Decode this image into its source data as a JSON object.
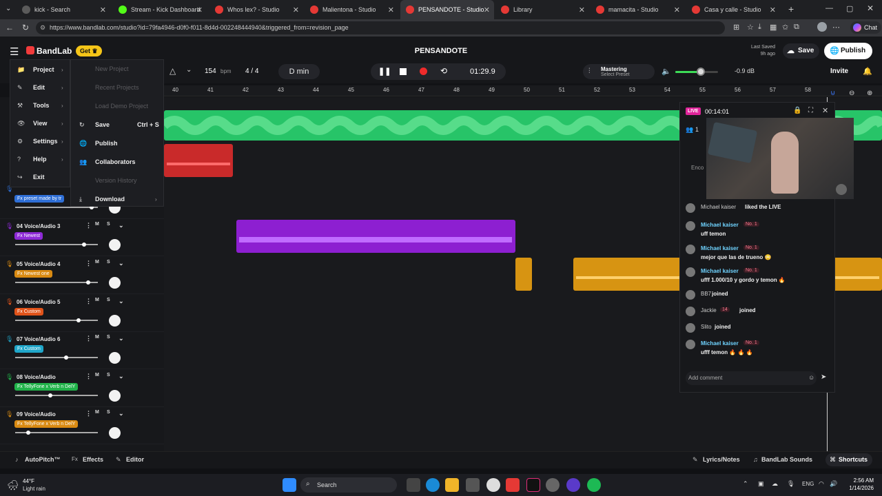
{
  "browser": {
    "tabs": [
      {
        "label": "kick - Search",
        "color": "#5b5b5b"
      },
      {
        "label": "Stream - Kick Dashboard",
        "color": "#53fc18"
      },
      {
        "label": "Whos lex? - Studio",
        "color": "#e53935"
      },
      {
        "label": "Malientona - Studio",
        "color": "#e53935"
      },
      {
        "label": "PENSANDOTE - Studio",
        "color": "#e53935"
      },
      {
        "label": "Library",
        "color": "#e53935"
      },
      {
        "label": "mamacita - Studio",
        "color": "#e53935"
      },
      {
        "label": "Casa y calle - Studio",
        "color": "#e53935"
      }
    ],
    "url": "https://www.bandlab.com/studio?id=79fa4946-d0f0-f011-8d4d-002248444940&triggered_from=revision_page",
    "profile_label": "Chat"
  },
  "header": {
    "logo": "BandLab",
    "get_label": "Get",
    "project_title": "PENSANDOTE",
    "last_saved_label": "Last Saved",
    "last_saved_time": "9h ago",
    "save_label": "Save",
    "publish_label": "Publish"
  },
  "transport": {
    "bpm": "154",
    "bpm_unit": "bpm",
    "time_signature": "4 / 4",
    "key": "D min",
    "time": "01:29.9",
    "mastering_label": "Mastering",
    "mastering_preset": "Select Preset",
    "volume_db": "-0.9 dB",
    "invite_label": "Invite",
    "volume_level": 0.6
  },
  "ruler": [
    "40",
    "41",
    "42",
    "43",
    "44",
    "45",
    "46",
    "47",
    "48",
    "49",
    "50",
    "51",
    "52",
    "53",
    "54",
    "55",
    "56",
    "57",
    "58"
  ],
  "main_menu": [
    {
      "label": "Project"
    },
    {
      "label": "Edit"
    },
    {
      "label": "Tools"
    },
    {
      "label": "View"
    },
    {
      "label": "Settings"
    },
    {
      "label": "Help"
    },
    {
      "label": "Exit"
    }
  ],
  "project_submenu": [
    {
      "label": "New Project",
      "disabled": true,
      "shortcut": ""
    },
    {
      "label": "Recent Projects",
      "disabled": true,
      "shortcut": ""
    },
    {
      "label": "Load Demo Project",
      "disabled": true,
      "shortcut": ""
    },
    {
      "label": "Save",
      "disabled": false,
      "shortcut": "Ctrl + S"
    },
    {
      "label": "Publish",
      "disabled": false,
      "shortcut": ""
    },
    {
      "label": "Collaborators",
      "disabled": false,
      "shortcut": ""
    },
    {
      "label": "Version History",
      "disabled": true,
      "shortcut": ""
    },
    {
      "label": "Download",
      "disabled": false,
      "shortcut": ""
    }
  ],
  "tracks": [
    {
      "name": "",
      "fx": "Fx preset made by tr",
      "fx_color": "#2f6fd6",
      "volume": 0.95
    },
    {
      "name": "04 Voice/Audio 3",
      "fx": "Fx Newest",
      "fx_color": "#8e2ad6",
      "volume": 0.85
    },
    {
      "name": "05 Voice/Audio 4",
      "fx": "Fx Newest one",
      "fx_color": "#d98a12",
      "volume": 0.9
    },
    {
      "name": "06 Voice/Audio 5",
      "fx": "Fx Custom",
      "fx_color": "#e0531a",
      "volume": 0.78
    },
    {
      "name": "07 Voice/Audio 6",
      "fx": "Fx Custom",
      "fx_color": "#1fa6c9",
      "volume": 0.62
    },
    {
      "name": "08 Voice/Audio",
      "fx": "Fx TellyFone x Verb n DelY",
      "fx_color": "#21b34a",
      "volume": 0.42
    },
    {
      "name": "09 Voice/Audio",
      "fx": "Fx TellyFone x Verb n DelY",
      "fx_color": "#d98a12",
      "volume": 0.14
    }
  ],
  "track_buttons": {
    "mute": "M",
    "solo": "S"
  },
  "live": {
    "badge": "LIVE",
    "time": "00:14:01",
    "viewers": "1",
    "overlay_text": "Enco",
    "chat": [
      {
        "user": "Michael kaiser",
        "text": "liked the LIVE",
        "badge": ""
      },
      {
        "user": "Michael kaiser",
        "text": "uff temon",
        "badge": "No. 1"
      },
      {
        "user": "Michael kaiser",
        "text": "mejor que las de trueno 😳",
        "badge": "No. 1"
      },
      {
        "user": "Michael kaiser",
        "text": "ufff 1.000/10 y gordo y temon 🔥",
        "badge": "No. 1"
      },
      {
        "user": "BB7",
        "text": "joined",
        "badge": ""
      },
      {
        "user": "Jackie",
        "text": "joined",
        "badge": "14"
      },
      {
        "user": "Slito",
        "text": "joined",
        "badge": ""
      },
      {
        "user": "Michael kaiser",
        "text": "ufff temon 🔥 🔥 🔥",
        "badge": "No. 1"
      }
    ],
    "comment_placeholder": "Add comment"
  },
  "bottom_bar": {
    "autopitch": "AutoPitch™",
    "effects": "Effects",
    "editor": "Editor",
    "lyrics": "Lyrics/Notes",
    "sounds": "BandLab Sounds",
    "shortcuts": "Shortcuts"
  },
  "taskbar": {
    "weather_temp": "44°F",
    "weather_desc": "Light rain",
    "search": "Search",
    "lang": "ENG",
    "time": "2:56 AM",
    "date": "1/14/2026"
  }
}
